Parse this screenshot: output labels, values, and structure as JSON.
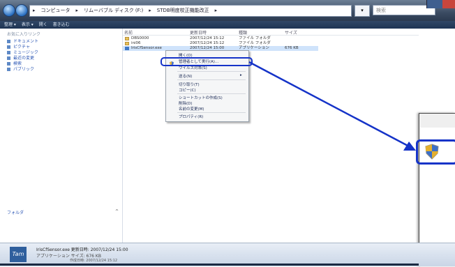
{
  "address": {
    "segments": [
      "▸",
      "コンピュータ",
      "▸",
      "リムーバブル ディスク (F:)",
      "▸",
      "STDB明度校正機能改正",
      "▸"
    ],
    "search_placeholder": "検索"
  },
  "toolbar": {
    "items": [
      "整理 ▾",
      "表示 ▾",
      "開く",
      "書き込む"
    ]
  },
  "left_pane": {
    "header": "お気に入りリンク",
    "items": [
      "ドキュメント",
      "ピクチャ",
      "ミュージック",
      "最近の変更",
      "検索",
      "パブリック"
    ],
    "folders_label": "フォルダ",
    "folders_chevron": "^"
  },
  "file_list": {
    "columns": [
      "名前",
      "更新日時",
      "種類",
      "サイズ"
    ],
    "rows": [
      {
        "name": "DBS0000",
        "date": "2007/12/24 15:12",
        "type": "ファイル フォルダ",
        "size": ""
      },
      {
        "name": "ini06",
        "date": "2007/12/24 15:12",
        "type": "ファイル フォルダ",
        "size": ""
      },
      {
        "name": "IrisCfSensor.exe",
        "date": "2007/12/24 15:00",
        "type": "アプリケーション",
        "size": "676 KB"
      }
    ]
  },
  "context_menu": {
    "items": [
      "開く(O)",
      "管理者として実行(A)...",
      "ウイルス対策(S)",
      "送る(N)",
      "切り取り(T)",
      "コピー(C)",
      "ショートカットの作成(S)",
      "削除(D)",
      "名前の変更(M)",
      "プロパティ(R)"
    ],
    "submenu_arrow": "▸"
  },
  "details": {
    "logo": "Tam",
    "name_line": "IrisCfSensor.exe   更新日時: 2007/12/24 15:00",
    "type_line": "アプリケーション   サイズ: 676 KB",
    "created_line": "作成日時: 2007/12/24 15:12"
  },
  "colors": {
    "highlight_blue": "#1533c8",
    "arrow_blue": "#1533c8"
  },
  "icons": [
    "folder-icon",
    "application-icon",
    "shield-icon"
  ]
}
